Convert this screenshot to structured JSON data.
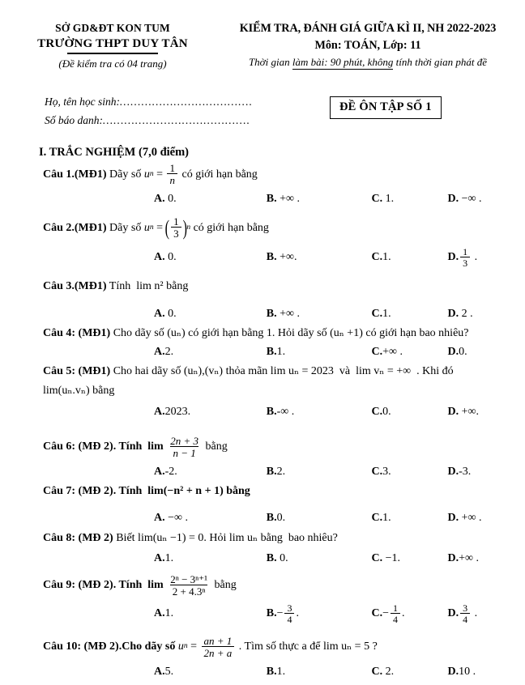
{
  "header": {
    "left": {
      "department": "SỞ GD&ĐT KON TUM",
      "school": "TRƯỜNG THPT DUY TÂN",
      "pages_note": "(Đề kiểm tra có 04 trang)"
    },
    "right": {
      "title": "KIỂM TRA, ĐÁNH GIÁ GIỮA KÌ II, NH 2022-2023",
      "subject": "Môn: TOÁN,  Lớp: 11",
      "duration_prefix": "Thời gian ",
      "duration_underlined": "làm bài: 90 phút, không",
      "duration_suffix": " tính thời gian phát đề"
    }
  },
  "student_info": {
    "name_label": "Họ, tên học sinh:",
    "name_dots": "……………………………….",
    "id_label": "Số báo danh:",
    "id_dots": "…………….…………………….",
    "exam_code": "ĐỀ ÔN TẬP SỐ 1"
  },
  "section": {
    "title": "I. TRẮC NGHIỆM (7,0 điểm)"
  },
  "questions": [
    {
      "label": "Câu 1.(MĐ1)",
      "text_before": " Dãy số ",
      "var": "u",
      "sub": "n",
      "eq": " = ",
      "frac_num": "1",
      "frac_den": "n",
      "text_after": " có giới hạn bằng",
      "options": [
        {
          "letter": "A.",
          "value": " 0."
        },
        {
          "letter": "B.",
          "value": " +∞ ."
        },
        {
          "letter": "C.",
          "value": " 1."
        },
        {
          "letter": "D.",
          "value": " −∞ ."
        }
      ]
    },
    {
      "label": "Câu 2.(MĐ1)",
      "text_before": " Dãy số ",
      "var": "u",
      "sub": "n",
      "eq": " = ",
      "frac_num": "1",
      "frac_den": "3",
      "exponent": "n",
      "text_after": " có giới hạn bằng",
      "options": [
        {
          "letter": "A.",
          "value": " 0."
        },
        {
          "letter": "B.",
          "value": " +∞."
        },
        {
          "letter": "C.",
          "value": "1."
        },
        {
          "letter": "D.",
          "value": "",
          "frac_num": "1",
          "frac_den": "3",
          "suffix": " ."
        }
      ]
    },
    {
      "label": "Câu 3.(MĐ1)",
      "text": " Tính  lim n² bằng",
      "options": [
        {
          "letter": "A.",
          "value": " 0."
        },
        {
          "letter": "B.",
          "value": " +∞ ."
        },
        {
          "letter": "C.",
          "value": "1."
        },
        {
          "letter": "D.",
          "value": " 2 ."
        }
      ]
    },
    {
      "label": "Câu 4: (MĐ1)",
      "text": " Cho dãy số (uₙ) có giới hạn bằng 1. Hỏi dãy số (uₙ +1) có giới hạn bao nhiêu?",
      "options": [
        {
          "letter": "A.",
          "value": "2."
        },
        {
          "letter": "B.",
          "value": "1."
        },
        {
          "letter": "C.",
          "value": "+∞ ."
        },
        {
          "letter": "D.",
          "value": "0."
        }
      ]
    },
    {
      "label": "Câu 5: (MĐ1)",
      "text": " Cho hai dãy số (uₙ),(vₙ) thỏa mãn lim uₙ = 2023  và  lim vₙ = +∞  . Khi đó",
      "text_line2": "lim(uₙ.vₙ) bằng",
      "options": [
        {
          "letter": "A.",
          "value": "2023."
        },
        {
          "letter": "B.",
          "value": "-∞ ."
        },
        {
          "letter": "C.",
          "value": "0."
        },
        {
          "letter": "D.",
          "value": " +∞."
        }
      ]
    },
    {
      "label": "Câu 6: (MĐ 2)",
      "text_before": ". Tính  lim ",
      "frac_num": "2n + 3",
      "frac_den": "n − 1",
      "text_after": " bằng",
      "options": [
        {
          "letter": "A.",
          "value": "-2."
        },
        {
          "letter": "B.",
          "value": "2."
        },
        {
          "letter": "C.",
          "value": "3."
        },
        {
          "letter": "D.",
          "value": "-3."
        }
      ]
    },
    {
      "label": "Câu 7: (MĐ 2)",
      "text": ". Tính  lim(−n² + n + 1) bằng",
      "options": [
        {
          "letter": "A.",
          "value": " −∞ ."
        },
        {
          "letter": "B.",
          "value": "0."
        },
        {
          "letter": "C.",
          "value": "1."
        },
        {
          "letter": "D.",
          "value": " +∞ ."
        }
      ]
    },
    {
      "label": "Câu 8: (MĐ 2)",
      "text": " Biết lim(uₙ −1) = 0. Hỏi lim uₙ bằng  bao nhiêu?",
      "options": [
        {
          "letter": "A.",
          "value": "1."
        },
        {
          "letter": "B.",
          "value": " 0."
        },
        {
          "letter": "C.",
          "value": " −1."
        },
        {
          "letter": "D.",
          "value": "+∞ ."
        }
      ]
    },
    {
      "label": "Câu 9: (MĐ 2)",
      "text_before": ". Tính  lim ",
      "frac_num": "2ⁿ − 3ⁿ⁺¹",
      "frac_den": "2 + 4.3ⁿ",
      "text_after": " bằng",
      "options": [
        {
          "letter": "A.",
          "value": "1."
        },
        {
          "letter": "B.",
          "value": "−",
          "frac_num": "3",
          "frac_den": "4",
          "suffix": "."
        },
        {
          "letter": "C.",
          "value": "−",
          "frac_num": "1",
          "frac_den": "4",
          "suffix": "."
        },
        {
          "letter": "D.",
          "value": "",
          "frac_num": "3",
          "frac_den": "4",
          "suffix": " ."
        }
      ]
    },
    {
      "label": "Câu 10: (MĐ 2)",
      "text_before": ".Cho dãy số ",
      "var": "u",
      "sub": "n",
      "eq": " = ",
      "frac_num": "an + 1",
      "frac_den": "2n + a",
      "text_after": " . Tìm số thực a để lim uₙ = 5 ?",
      "options": [
        {
          "letter": "A.",
          "value": "5."
        },
        {
          "letter": "B.",
          "value": "1."
        },
        {
          "letter": "C.",
          "value": " 2."
        },
        {
          "letter": "D.",
          "value": "10 ."
        }
      ]
    }
  ]
}
